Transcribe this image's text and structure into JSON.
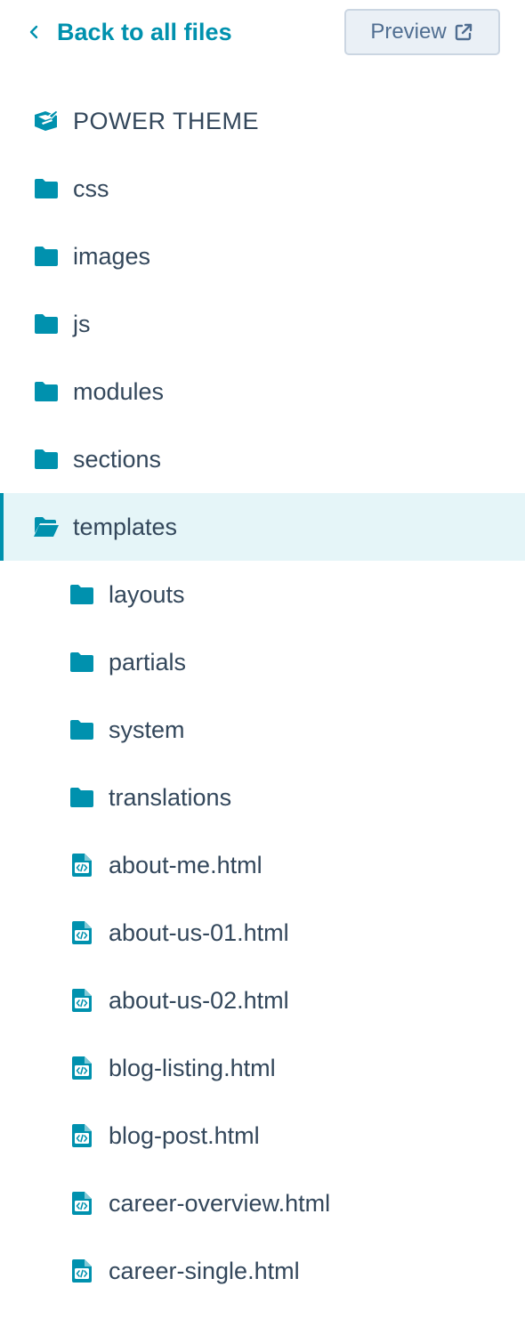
{
  "header": {
    "back_label": "Back to all files",
    "preview_label": "Preview"
  },
  "colors": {
    "accent": "#0091ae",
    "text": "#33475b",
    "selected_bg": "#e5f5f8",
    "button_bg": "#eaf0f6",
    "button_border": "#cbd6e2"
  },
  "tree": {
    "theme": {
      "label": "POWER THEME",
      "icon": "theme-icon"
    },
    "folders": [
      {
        "label": "css",
        "icon": "folder-icon"
      },
      {
        "label": "images",
        "icon": "folder-icon"
      },
      {
        "label": "js",
        "icon": "folder-icon"
      },
      {
        "label": "modules",
        "icon": "folder-icon"
      },
      {
        "label": "sections",
        "icon": "folder-icon"
      },
      {
        "label": "templates",
        "icon": "folder-open-icon",
        "selected": true
      }
    ],
    "templates_children": [
      {
        "label": "layouts",
        "icon": "folder-icon"
      },
      {
        "label": "partials",
        "icon": "folder-icon"
      },
      {
        "label": "system",
        "icon": "folder-icon"
      },
      {
        "label": "translations",
        "icon": "folder-icon"
      },
      {
        "label": "about-me.html",
        "icon": "html-file-icon"
      },
      {
        "label": "about-us-01.html",
        "icon": "html-file-icon"
      },
      {
        "label": "about-us-02.html",
        "icon": "html-file-icon"
      },
      {
        "label": "blog-listing.html",
        "icon": "html-file-icon"
      },
      {
        "label": "blog-post.html",
        "icon": "html-file-icon"
      },
      {
        "label": "career-overview.html",
        "icon": "html-file-icon"
      },
      {
        "label": "career-single.html",
        "icon": "html-file-icon"
      }
    ]
  }
}
